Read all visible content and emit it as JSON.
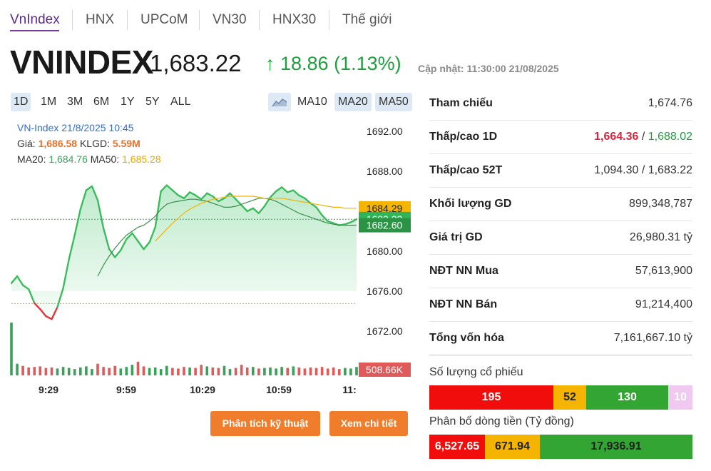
{
  "tabs": [
    {
      "label": "VnIndex",
      "active": true
    },
    {
      "label": "HNX"
    },
    {
      "label": "UPCoM"
    },
    {
      "label": "VN30"
    },
    {
      "label": "HNX30"
    },
    {
      "label": "Thế giới"
    }
  ],
  "header": {
    "name": "VNINDEX",
    "value": "1,683.22",
    "change": "↑ 18.86 (1.13%)",
    "update": "Cập nhật: 11:30:00 21/08/2025"
  },
  "periods": [
    "1D",
    "1M",
    "3M",
    "6M",
    "1Y",
    "5Y",
    "ALL"
  ],
  "ma_buttons": [
    "MA10",
    "MA20",
    "MA50"
  ],
  "chart_info": {
    "title": "VN-Index 21/8/2025 10:45",
    "price_label": "Giá:",
    "price": "1,686.58",
    "vol_label": "KLGD:",
    "vol": "5.59M",
    "ma20_label": "MA20:",
    "ma20": "1,684.76",
    "ma50_label": "MA50:",
    "ma50": "1,685.28"
  },
  "chart_data": {
    "type": "line",
    "y_ticks": [
      "1692.00",
      "1688.00",
      "1680.00",
      "1676.00",
      "1672.00"
    ],
    "x_ticks": [
      "9:29",
      "9:59",
      "10:29",
      "10:59",
      "11:"
    ],
    "reference": 1674.76,
    "price_tags": [
      {
        "value": "1684.29",
        "color": "#f5b400"
      },
      {
        "value": "1683.22",
        "color": "#2fb457"
      },
      {
        "value": "1682.60",
        "color": "#2a9444"
      }
    ],
    "volume_tag": {
      "value": "508.66K",
      "color": "#e05a5a"
    },
    "price": [
      1676.8,
      1677.5,
      1676.6,
      1676.2,
      1674.8,
      1674.2,
      1673.5,
      1673.2,
      1674.4,
      1676.3,
      1679.2,
      1681.6,
      1684.2,
      1686.1,
      1686.5,
      1685.1,
      1682.3,
      1680.2,
      1679.4,
      1680.1,
      1681.2,
      1681.8,
      1681.0,
      1680.2,
      1680.9,
      1682.4,
      1686.0,
      1686.6,
      1686.1,
      1685.6,
      1685.3,
      1685.9,
      1685.6,
      1685.2,
      1685.8,
      1685.5,
      1685.0,
      1685.3,
      1685.8,
      1685.2,
      1684.6,
      1684.0,
      1684.3,
      1683.8,
      1684.5,
      1685.4,
      1686.0,
      1686.4,
      1685.9,
      1686.1,
      1685.6,
      1685.3,
      1684.8,
      1684.4,
      1683.6,
      1683.0,
      1682.8,
      1682.6,
      1682.7,
      1682.9,
      1683.2
    ],
    "ma20": [
      null,
      null,
      null,
      null,
      null,
      null,
      null,
      null,
      null,
      null,
      null,
      null,
      null,
      null,
      null,
      1677.5,
      1678.6,
      1679.5,
      1680.3,
      1681.0,
      1681.6,
      1682.0,
      1682.4,
      1682.6,
      1683.0,
      1683.5,
      1684.2,
      1684.7,
      1684.9,
      1685.0,
      1685.1,
      1685.2,
      1685.2,
      1685.1,
      1685.0,
      1684.8,
      1684.6,
      1684.4,
      1684.4,
      1684.5,
      1684.7,
      1684.9,
      1685.1,
      1685.3,
      1685.3,
      1685.2,
      1685.0,
      1684.7,
      1684.4,
      1684.1,
      1683.8,
      1683.6,
      1683.4,
      1683.2,
      1683.0,
      1682.8,
      1682.7,
      1682.6,
      1682.6,
      1682.6,
      1682.6
    ],
    "ma50": [
      null,
      null,
      null,
      null,
      null,
      null,
      null,
      null,
      null,
      null,
      null,
      null,
      null,
      null,
      null,
      null,
      null,
      null,
      null,
      null,
      null,
      null,
      null,
      null,
      null,
      1681.0,
      1681.6,
      1682.2,
      1682.8,
      1683.3,
      1683.8,
      1684.2,
      1684.5,
      1684.8,
      1685.0,
      1685.2,
      1685.3,
      1685.4,
      1685.5,
      1685.5,
      1685.5,
      1685.5,
      1685.5,
      1685.4,
      1685.3,
      1685.3,
      1685.3,
      1685.3,
      1685.2,
      1685.1,
      1685.0,
      1684.9,
      1684.8,
      1684.7,
      1684.6,
      1684.5,
      1684.4,
      1684.4,
      1684.3,
      1684.3,
      1684.3
    ],
    "volume": [
      1000,
      220,
      180,
      150,
      160,
      170,
      140,
      150,
      130,
      160,
      140,
      120,
      150,
      170,
      120,
      220,
      160,
      140,
      180,
      130,
      160,
      200,
      260,
      170,
      140,
      150,
      120,
      180,
      140,
      130,
      160,
      150,
      140,
      200,
      170,
      150,
      140,
      180,
      120,
      140,
      200,
      150,
      160,
      130,
      140,
      150,
      130,
      160,
      140,
      170,
      150,
      130,
      150,
      140,
      160,
      130,
      150,
      120,
      140,
      130,
      160
    ]
  },
  "actions": {
    "technical": "Phân tích kỹ thuật",
    "details": "Xem chi tiết"
  },
  "stats": [
    {
      "label": "Tham chiếu",
      "value": "1,674.76"
    },
    {
      "label": "Thấp/cao 1D",
      "low": "1,664.36",
      "sep": " / ",
      "high": "1,688.02"
    },
    {
      "label": "Thấp/cao 52T",
      "value": "1,094.30 / 1,683.22"
    },
    {
      "label": "Khối lượng GD",
      "value": "899,348,787"
    },
    {
      "label": "Giá trị GD",
      "value": "26,980.31 tỷ"
    },
    {
      "label": "NĐT NN Mua",
      "value": "57,613,900"
    },
    {
      "label": "NĐT NN Bán",
      "value": "91,214,400"
    },
    {
      "label": "Tổng vốn hóa",
      "value": "7,161,667.10 tỷ"
    }
  ],
  "stock_count": {
    "label": "Số lượng cổ phiếu",
    "segments": [
      {
        "value": "195",
        "color": "#f20d0d"
      },
      {
        "value": "52",
        "color": "#f5b400"
      },
      {
        "value": "130",
        "color": "#33a532"
      },
      {
        "value": "10",
        "color": "#f0c8f0"
      }
    ]
  },
  "money_flow": {
    "label": "Phân bố dòng tiền (Tỷ đồng)",
    "segments": [
      {
        "value": "6,527.65",
        "color": "#f20d0d"
      },
      {
        "value": "671.94",
        "color": "#f5b400"
      },
      {
        "value": "17,936.91",
        "color": "#33a532"
      }
    ]
  }
}
